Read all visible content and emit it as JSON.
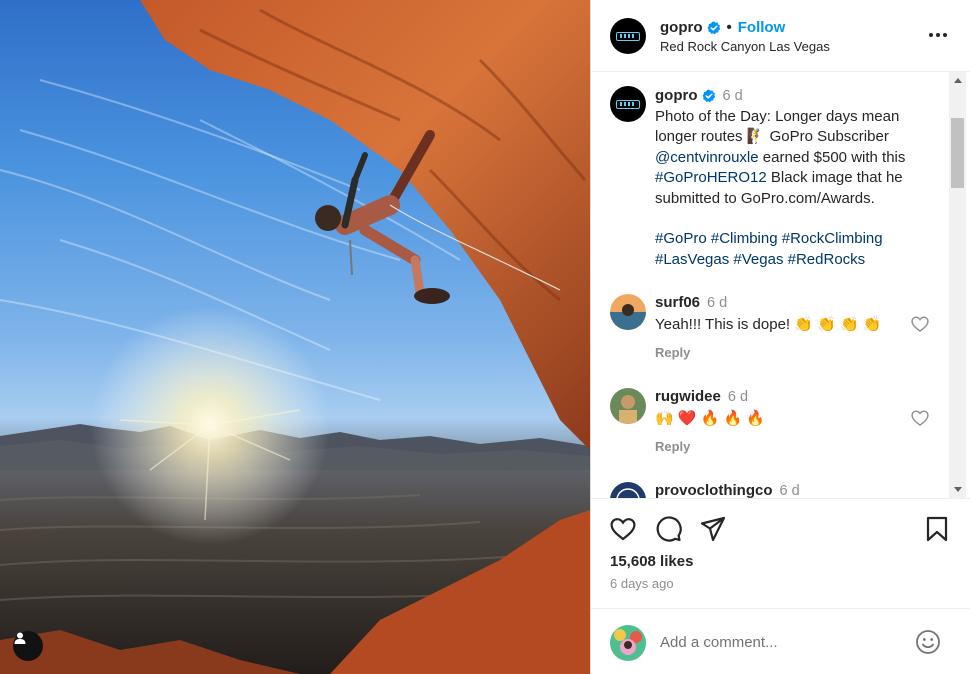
{
  "post": {
    "username": "gopro",
    "follow_label": "Follow",
    "separator": "•",
    "location": "Red Rock Canyon Las Vegas"
  },
  "caption": {
    "username": "gopro",
    "time": "6 d",
    "line1": "Photo of the Day: Longer days mean longer routes",
    "line1_emoji": "🧗",
    "pre_mention": "GoPro Subscriber",
    "mention": "@centvinrouxle",
    "mid_text": "earned $500 with this",
    "tag_hero": "#GoProHERO12",
    "post_text": "Black image that he submitted to GoPro.com/Awards.",
    "hashtags": [
      "#GoPro",
      "#Climbing",
      "#RockClimbing",
      "#LasVegas",
      "#Vegas",
      "#RedRocks"
    ]
  },
  "comments": [
    {
      "username": "surf06",
      "time": "6 d",
      "text": "Yeah!!! This is dope! 👏 👏 👏 👏",
      "reply": "Reply"
    },
    {
      "username": "rugwidee",
      "time": "6 d",
      "text": "🙌 ❤️ 🔥 🔥 🔥",
      "reply": "Reply"
    },
    {
      "username": "provoclothingco",
      "time": "6 d"
    }
  ],
  "engagement": {
    "likes": "15,608 likes",
    "ago": "6 days ago"
  },
  "composer": {
    "placeholder": "Add a comment..."
  },
  "colors": {
    "accent": "#0095f6",
    "verified": "#0095f6",
    "link": "#00376b",
    "muted": "#8e8e8e",
    "like_red": "#ed4956"
  },
  "icons": [
    "verified-badge-icon",
    "more-options-icon",
    "heart-icon",
    "comment-icon",
    "share-icon",
    "bookmark-icon",
    "emoji-icon",
    "user-tag-icon"
  ]
}
